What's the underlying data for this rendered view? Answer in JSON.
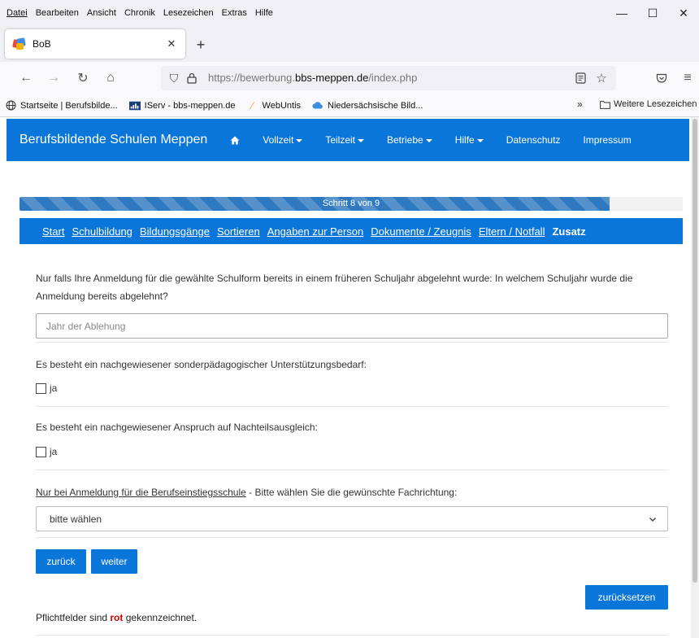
{
  "browser": {
    "menu": [
      "Datei",
      "Bearbeiten",
      "Ansicht",
      "Chronik",
      "Lesezeichen",
      "Extras",
      "Hilfe"
    ],
    "window_controls": {
      "minimize": "—",
      "maximize": "☐",
      "close": "✕"
    },
    "tab": {
      "title": "BoB",
      "close": "✕"
    },
    "new_tab": "+",
    "url": {
      "prefix": "https://bewerbung.",
      "domain": "bbs-meppen.de",
      "path": "/index.php"
    },
    "bookmarks": [
      {
        "label": "Startseite | Berufsbilde...",
        "icon": "globe-icon"
      },
      {
        "label": "IServ - bbs-meppen.de",
        "icon": "iserv-icon"
      },
      {
        "label": "WebUntis",
        "icon": "webuntis-icon"
      },
      {
        "label": "Niedersächsische Bild...",
        "icon": "cloud-icon"
      }
    ],
    "bookmarks_overflow": "»",
    "more_bookmarks": "Weitere Lesezeichen"
  },
  "site": {
    "brand": "Berufsbildende Schulen Meppen",
    "nav": [
      {
        "label": "Vollzeit",
        "dropdown": true
      },
      {
        "label": "Teilzeit",
        "dropdown": true
      },
      {
        "label": "Betriebe",
        "dropdown": true
      },
      {
        "label": "Hilfe",
        "dropdown": true
      },
      {
        "label": "Datenschutz",
        "dropdown": false
      },
      {
        "label": "Impressum",
        "dropdown": false
      }
    ]
  },
  "progress": {
    "label": "Schritt 8 von 9",
    "fraction": 0.89
  },
  "steps": [
    "Start",
    "Schulbildung",
    "Bildungsgänge",
    "Sortieren",
    "Angaben zur Person",
    "Dokumente / Zeugnis",
    "Eltern / Notfall",
    "Zusatz"
  ],
  "form": {
    "rejection_question_line1": "Nur falls Ihre Anmeldung für die gewählte Schulform bereits in einem früheren Schuljahr abgelehnt wurde: In welchem Schuljahr wurde die",
    "rejection_question_line2": "Anmeldung bereits abgelehnt?",
    "rejection_placeholder": "Jahr der Ablehung",
    "support_question": "Es besteht ein nachgewiesener sonderpädagogischer Unterstützungsbedarf:",
    "support_checkbox": "ja",
    "compensation_question": "Es besteht ein nachgewiesener Anspruch auf Nachteilsausgleich:",
    "compensation_checkbox": "ja",
    "fachrichtung_question_link": "Nur bei Anmeldung für die Berufseinstiegsschule",
    "fachrichtung_question_rest": " - Bitte wählen Sie die gewünschte Fachrichtung:",
    "fachrichtung_selected": "bitte wählen"
  },
  "buttons": {
    "back": "zurück",
    "next": "weiter",
    "reset": "zurücksetzen"
  },
  "footer_note": {
    "before": "Pflichtfelder sind ",
    "highlight": "rot",
    "after": " gekennzeichnet."
  },
  "colors": {
    "primary": "#0b76d9",
    "progress": "#2f79c0",
    "required": "#d10000"
  }
}
